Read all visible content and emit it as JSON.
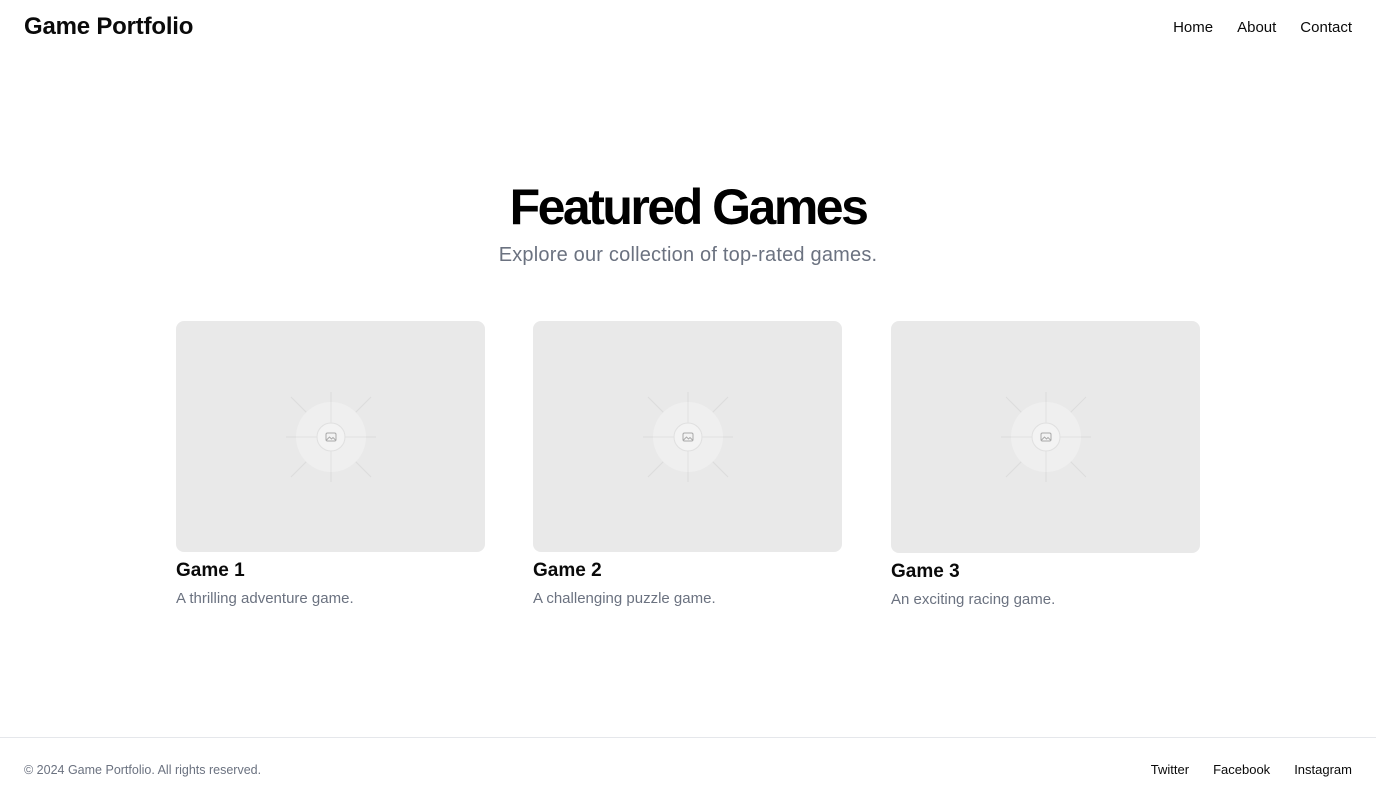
{
  "header": {
    "logo": "Game Portfolio",
    "nav": [
      "Home",
      "About",
      "Contact"
    ]
  },
  "hero": {
    "title": "Featured Games",
    "subtitle": "Explore our collection of top-rated games."
  },
  "games": [
    {
      "title": "Game 1",
      "description": "A thrilling adventure game."
    },
    {
      "title": "Game 2",
      "description": "A challenging puzzle game."
    },
    {
      "title": "Game 3",
      "description": "An exciting racing game."
    }
  ],
  "footer": {
    "copyright": "© 2024 Game Portfolio. All rights reserved.",
    "social": [
      "Twitter",
      "Facebook",
      "Instagram"
    ]
  },
  "colors": {
    "text": "#0a0a0a",
    "muted": "#6b7280",
    "placeholder_bg": "#e9e9e9",
    "border": "#e5e7eb"
  }
}
